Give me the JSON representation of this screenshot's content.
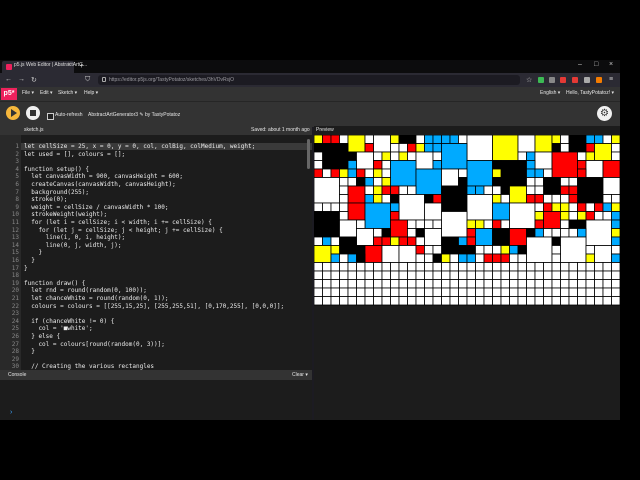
{
  "browser": {
    "tab_title": "p5.js Web Editor | AbstractArtG...",
    "url": "https://editor.p5js.org/TastyPotatoz/sketches/3hVDvRsjO",
    "new_tab": "+",
    "minimize": "–",
    "maximize": "□",
    "close": "×",
    "tab_close": "×"
  },
  "menu": {
    "logo": "p5*",
    "items": [
      "File ▾",
      "Edit ▾",
      "Sketch ▾",
      "Help ▾"
    ],
    "language": "English ▾",
    "user": "Hello, TastyPotatoz! ▾"
  },
  "toolbar": {
    "auto_refresh": "Auto-refresh",
    "sketch_name": "AbstractArtGenerator3 ✎",
    "by": "by TastyPotatoz"
  },
  "file": {
    "name": "sketch.js",
    "saved": "Saved: about 1 month ago"
  },
  "preview_label": "Preview",
  "console": {
    "label": "Console",
    "clear": "Clear ▾",
    "prompt": "›"
  },
  "colors": {
    "yellow": "#ffff00",
    "blue": "#00aaff",
    "red": "#ff0000",
    "black": "#000000",
    "white": "#ffffff",
    "accent": "#ed225d"
  },
  "code": [
    "let cellSize = 25, x = 0, y = 0, col, colBig, colMedium, weight;",
    "let used = [], colours = [];",
    "",
    "function setup() {",
    "  let canvasWidth = 900, canvasHeight = 600;",
    "  createCanvas(canvasWidth, canvasHeight);",
    "  background(255);",
    "  stroke(0);",
    "  weight = cellSize / canvasWidth * 100;",
    "  strokeWeight(weight);",
    "  for (let i = cellSize; i < width; i += cellSize) {",
    "    for (let j = cellSize; j < height; j += cellSize) {",
    "      line(i, 0, i, height);",
    "      line(0, j, width, j);",
    "    }",
    "  }",
    "}",
    "",
    "function draw() {",
    "  let rnd = round(random(0, 100));",
    "  let chanceWhite = round(random(0, 1));",
    "  colours = colours = [[255,15,25], [255,255,51], [0,170,255], [0,0,0]];",
    "",
    "  if (chanceWhite != 0) {",
    "    col = '■white';",
    "  } else {",
    "    col = colours[round(random(0, 3))];",
    "  }",
    "",
    "  // Creating the various rectangles"
  ],
  "line_numbers": [
    "1",
    "2",
    "3",
    "4",
    "5",
    "6",
    "7",
    "8",
    "9",
    "10",
    "11",
    "12",
    "13",
    "14",
    "15",
    "16",
    "17",
    "18",
    "19",
    "20",
    "21",
    "22",
    "23",
    "24",
    "25",
    "26",
    "27",
    "28",
    "29",
    "30"
  ]
}
